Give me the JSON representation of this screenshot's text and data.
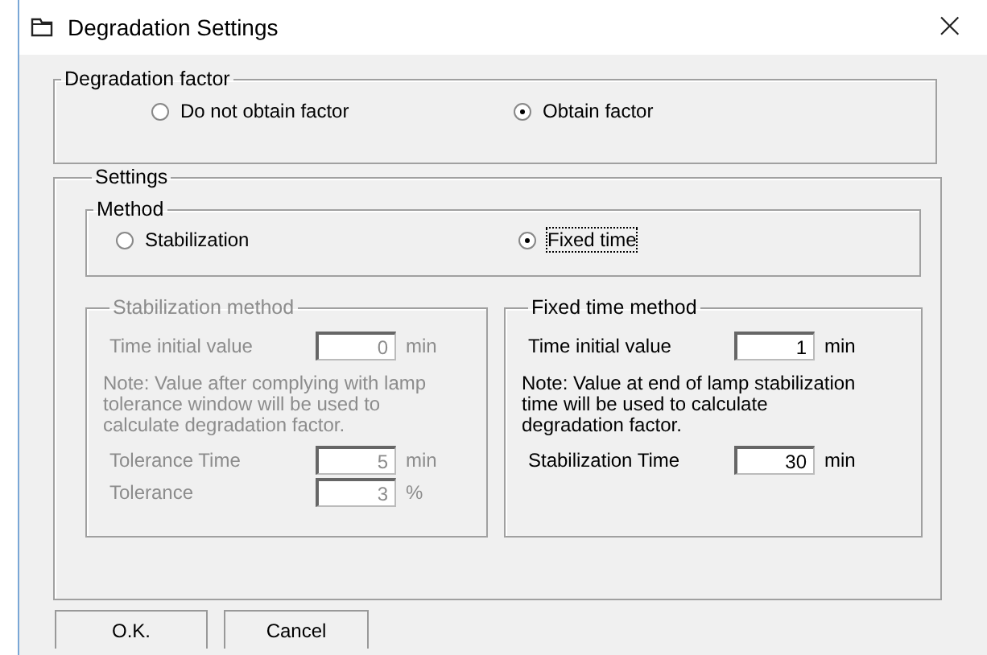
{
  "window": {
    "title": "Degradation Settings",
    "close": "×"
  },
  "degradation_factor": {
    "label": "Degradation factor",
    "options": [
      {
        "label": "Do not obtain factor",
        "selected": false
      },
      {
        "label": "Obtain factor",
        "selected": true
      }
    ]
  },
  "settings": {
    "label": "Settings",
    "method": {
      "label": "Method",
      "options": [
        {
          "label": "Stabilization",
          "selected": false
        },
        {
          "label": "Fixed time",
          "selected": true
        }
      ]
    },
    "panels": [
      {
        "label": "Stabilization method",
        "disabled": true,
        "fields": [
          {
            "label": "Time initial value",
            "value": "0",
            "unit": "min"
          }
        ],
        "note": "Note: Value after complying with lamp tolerance window will be used to calculate degradation factor.",
        "fields_after": [
          {
            "label": "Tolerance Time",
            "value": "5",
            "unit": "min"
          },
          {
            "label": "Tolerance",
            "value": "3",
            "unit": "%"
          }
        ]
      },
      {
        "label": "Fixed time method",
        "disabled": false,
        "fields": [
          {
            "label": "Time initial value",
            "value": "1",
            "unit": "min"
          }
        ],
        "note": "Note: Value at end of lamp stabilization time will be used to calculate degradation factor.",
        "fields_after": [
          {
            "label": "Stabilization Time",
            "value": "30",
            "unit": "min"
          }
        ]
      }
    ]
  },
  "buttons": [
    "O.K.",
    "Cancel"
  ]
}
